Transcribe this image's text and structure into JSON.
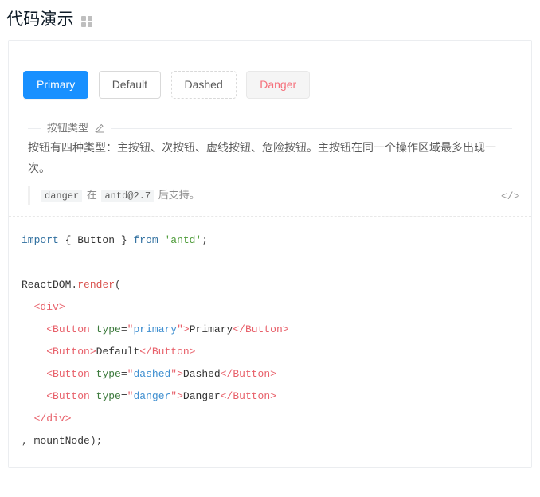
{
  "header": {
    "title": "代码演示",
    "icon": "appstore-grid-icon"
  },
  "demo": {
    "buttons": [
      {
        "label": "Primary",
        "type": "primary"
      },
      {
        "label": "Default",
        "type": "default"
      },
      {
        "label": "Dashed",
        "type": "dashed"
      },
      {
        "label": "Danger",
        "type": "danger"
      }
    ],
    "meta": {
      "title": "按钮类型",
      "edit_icon": "pencil-icon",
      "description": "按钮有四种类型：主按钮、次按钮、虚线按钮、危险按钮。主按钮在同一个操作区域最多出现一次。",
      "note": {
        "code1": "danger",
        "mid": "在",
        "code2": "antd@2.7",
        "tail": "后支持。"
      },
      "code_toggle_icon": "</>"
    }
  },
  "code": {
    "lines": [
      [
        {
          "t": "import",
          "c": "tok-kw"
        },
        {
          "t": " { Button } ",
          "c": "tok-plain"
        },
        {
          "t": "from",
          "c": "tok-kw"
        },
        {
          "t": " ",
          "c": "tok-plain"
        },
        {
          "t": "'antd'",
          "c": "tok-str"
        },
        {
          "t": ";",
          "c": "tok-punc"
        }
      ],
      [],
      [
        {
          "t": "ReactDOM",
          "c": "tok-plain"
        },
        {
          "t": ".",
          "c": "tok-punc"
        },
        {
          "t": "render",
          "c": "tok-fn"
        },
        {
          "t": "(",
          "c": "tok-punc"
        }
      ],
      [
        {
          "t": "  <",
          "c": "tok-tag"
        },
        {
          "t": "div",
          "c": "tok-tag"
        },
        {
          "t": ">",
          "c": "tok-tag"
        }
      ],
      [
        {
          "t": "    <",
          "c": "tok-tag"
        },
        {
          "t": "Button",
          "c": "tok-tag"
        },
        {
          "t": " ",
          "c": "tok-plain"
        },
        {
          "t": "type",
          "c": "tok-attr"
        },
        {
          "t": "=",
          "c": "tok-punc"
        },
        {
          "t": "\"",
          "c": "tok-tag"
        },
        {
          "t": "primary",
          "c": "tok-val"
        },
        {
          "t": "\"",
          "c": "tok-tag"
        },
        {
          "t": ">",
          "c": "tok-tag"
        },
        {
          "t": "Primary",
          "c": "tok-plain"
        },
        {
          "t": "</",
          "c": "tok-tag"
        },
        {
          "t": "Button",
          "c": "tok-tag"
        },
        {
          "t": ">",
          "c": "tok-tag"
        }
      ],
      [
        {
          "t": "    <",
          "c": "tok-tag"
        },
        {
          "t": "Button",
          "c": "tok-tag"
        },
        {
          "t": ">",
          "c": "tok-tag"
        },
        {
          "t": "Default",
          "c": "tok-plain"
        },
        {
          "t": "</",
          "c": "tok-tag"
        },
        {
          "t": "Button",
          "c": "tok-tag"
        },
        {
          "t": ">",
          "c": "tok-tag"
        }
      ],
      [
        {
          "t": "    <",
          "c": "tok-tag"
        },
        {
          "t": "Button",
          "c": "tok-tag"
        },
        {
          "t": " ",
          "c": "tok-plain"
        },
        {
          "t": "type",
          "c": "tok-attr"
        },
        {
          "t": "=",
          "c": "tok-punc"
        },
        {
          "t": "\"",
          "c": "tok-tag"
        },
        {
          "t": "dashed",
          "c": "tok-val"
        },
        {
          "t": "\"",
          "c": "tok-tag"
        },
        {
          "t": ">",
          "c": "tok-tag"
        },
        {
          "t": "Dashed",
          "c": "tok-plain"
        },
        {
          "t": "</",
          "c": "tok-tag"
        },
        {
          "t": "Button",
          "c": "tok-tag"
        },
        {
          "t": ">",
          "c": "tok-tag"
        }
      ],
      [
        {
          "t": "    <",
          "c": "tok-tag"
        },
        {
          "t": "Button",
          "c": "tok-tag"
        },
        {
          "t": " ",
          "c": "tok-plain"
        },
        {
          "t": "type",
          "c": "tok-attr"
        },
        {
          "t": "=",
          "c": "tok-punc"
        },
        {
          "t": "\"",
          "c": "tok-tag"
        },
        {
          "t": "danger",
          "c": "tok-val"
        },
        {
          "t": "\"",
          "c": "tok-tag"
        },
        {
          "t": ">",
          "c": "tok-tag"
        },
        {
          "t": "Danger",
          "c": "tok-plain"
        },
        {
          "t": "</",
          "c": "tok-tag"
        },
        {
          "t": "Button",
          "c": "tok-tag"
        },
        {
          "t": ">",
          "c": "tok-tag"
        }
      ],
      [
        {
          "t": "  </",
          "c": "tok-tag"
        },
        {
          "t": "div",
          "c": "tok-tag"
        },
        {
          "t": ">",
          "c": "tok-tag"
        }
      ],
      [
        {
          "t": ", ",
          "c": "tok-punc"
        },
        {
          "t": "mountNode",
          "c": "tok-plain"
        },
        {
          "t": ")",
          "c": "tok-punc"
        },
        {
          "t": ";",
          "c": "tok-punc"
        }
      ]
    ]
  },
  "colors": {
    "primary": "#1890ff",
    "danger_text": "#f5707b",
    "border": "#d9d9d9",
    "card_border": "#ebedf0",
    "title": "#0d1a26"
  }
}
